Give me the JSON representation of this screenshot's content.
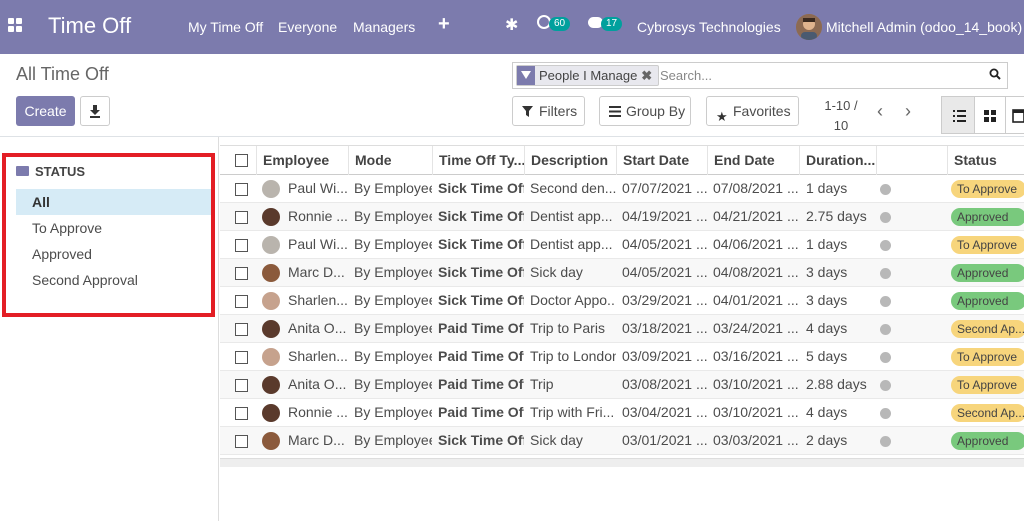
{
  "app": {
    "title": "Time Off",
    "menu": [
      "My Time Off",
      "Everyone",
      "Managers"
    ],
    "activity_count": "60",
    "message_count": "17",
    "company": "Cybrosys Technologies",
    "user": "Mitchell Admin (odoo_14_book)"
  },
  "control": {
    "breadcrumb": "All Time Off",
    "create_label": "Create",
    "facet_label": "People I Manage",
    "search_placeholder": "Search...",
    "filters_label": "Filters",
    "groupby_label": "Group By",
    "favorites_label": "Favorites",
    "pager_range": "1-10 /",
    "pager_total": "10"
  },
  "sidebar": {
    "heading": "STATUS",
    "items": [
      "All",
      "To Approve",
      "Approved",
      "Second Approval"
    ],
    "active": "All"
  },
  "table": {
    "columns": [
      "Employee",
      "Mode",
      "Time Off Ty...",
      "Description",
      "Start Date",
      "End Date",
      "Duration...",
      "",
      "Status"
    ],
    "rows": [
      {
        "employee": "Paul Wi...",
        "mode": "By Employee",
        "type": "Sick Time Off",
        "description": "Second den...",
        "start": "07/07/2021 ...",
        "end": "07/08/2021 ...",
        "duration": "1 days",
        "status": "To Approve",
        "avatar": "gray"
      },
      {
        "employee": "Ronnie ...",
        "mode": "By Employee",
        "type": "Sick Time Off",
        "description": "Dentist app...",
        "start": "04/19/2021 ...",
        "end": "04/21/2021 ...",
        "duration": "2.75 days",
        "status": "Approved",
        "avatar": "dark"
      },
      {
        "employee": "Paul Wi...",
        "mode": "By Employee",
        "type": "Sick Time Off",
        "description": "Dentist app...",
        "start": "04/05/2021 ...",
        "end": "04/06/2021 ...",
        "duration": "1 days",
        "status": "To Approve",
        "avatar": "gray"
      },
      {
        "employee": "Marc D...",
        "mode": "By Employee",
        "type": "Sick Time Off",
        "description": "Sick day",
        "start": "04/05/2021 ...",
        "end": "04/08/2021 ...",
        "duration": "3 days",
        "status": "Approved",
        "avatar": "brown"
      },
      {
        "employee": "Sharlen...",
        "mode": "By Employee",
        "type": "Sick Time Off",
        "description": "Doctor Appo...",
        "start": "03/29/2021 ...",
        "end": "04/01/2021 ...",
        "duration": "3 days",
        "status": "Approved",
        "avatar": "light"
      },
      {
        "employee": "Anita O...",
        "mode": "By Employee",
        "type": "Paid Time Off",
        "description": "Trip to Paris",
        "start": "03/18/2021 ...",
        "end": "03/24/2021 ...",
        "duration": "4 days",
        "status": "Second Ap...",
        "avatar": "dark"
      },
      {
        "employee": "Sharlen...",
        "mode": "By Employee",
        "type": "Paid Time Off",
        "description": "Trip to London",
        "start": "03/09/2021 ...",
        "end": "03/16/2021 ...",
        "duration": "5 days",
        "status": "To Approve",
        "avatar": "light"
      },
      {
        "employee": "Anita O...",
        "mode": "By Employee",
        "type": "Paid Time Off",
        "description": "Trip",
        "start": "03/08/2021 ...",
        "end": "03/10/2021 ...",
        "duration": "2.88 days",
        "status": "To Approve",
        "avatar": "dark"
      },
      {
        "employee": "Ronnie ...",
        "mode": "By Employee",
        "type": "Paid Time Off",
        "description": "Trip with Fri...",
        "start": "03/04/2021 ...",
        "end": "03/10/2021 ...",
        "duration": "4 days",
        "status": "Second Ap...",
        "avatar": "dark"
      },
      {
        "employee": "Marc D...",
        "mode": "By Employee",
        "type": "Sick Time Off",
        "description": "Sick day",
        "start": "03/01/2021 ...",
        "end": "03/03/2021 ...",
        "duration": "2 days",
        "status": "Approved",
        "avatar": "brown"
      }
    ]
  },
  "colors": {
    "brand": "#7c7bad",
    "approved": "#79c97d",
    "to_approve": "#f7d57c",
    "highlight_box": "#e31e25",
    "badge": "#00a09d"
  }
}
